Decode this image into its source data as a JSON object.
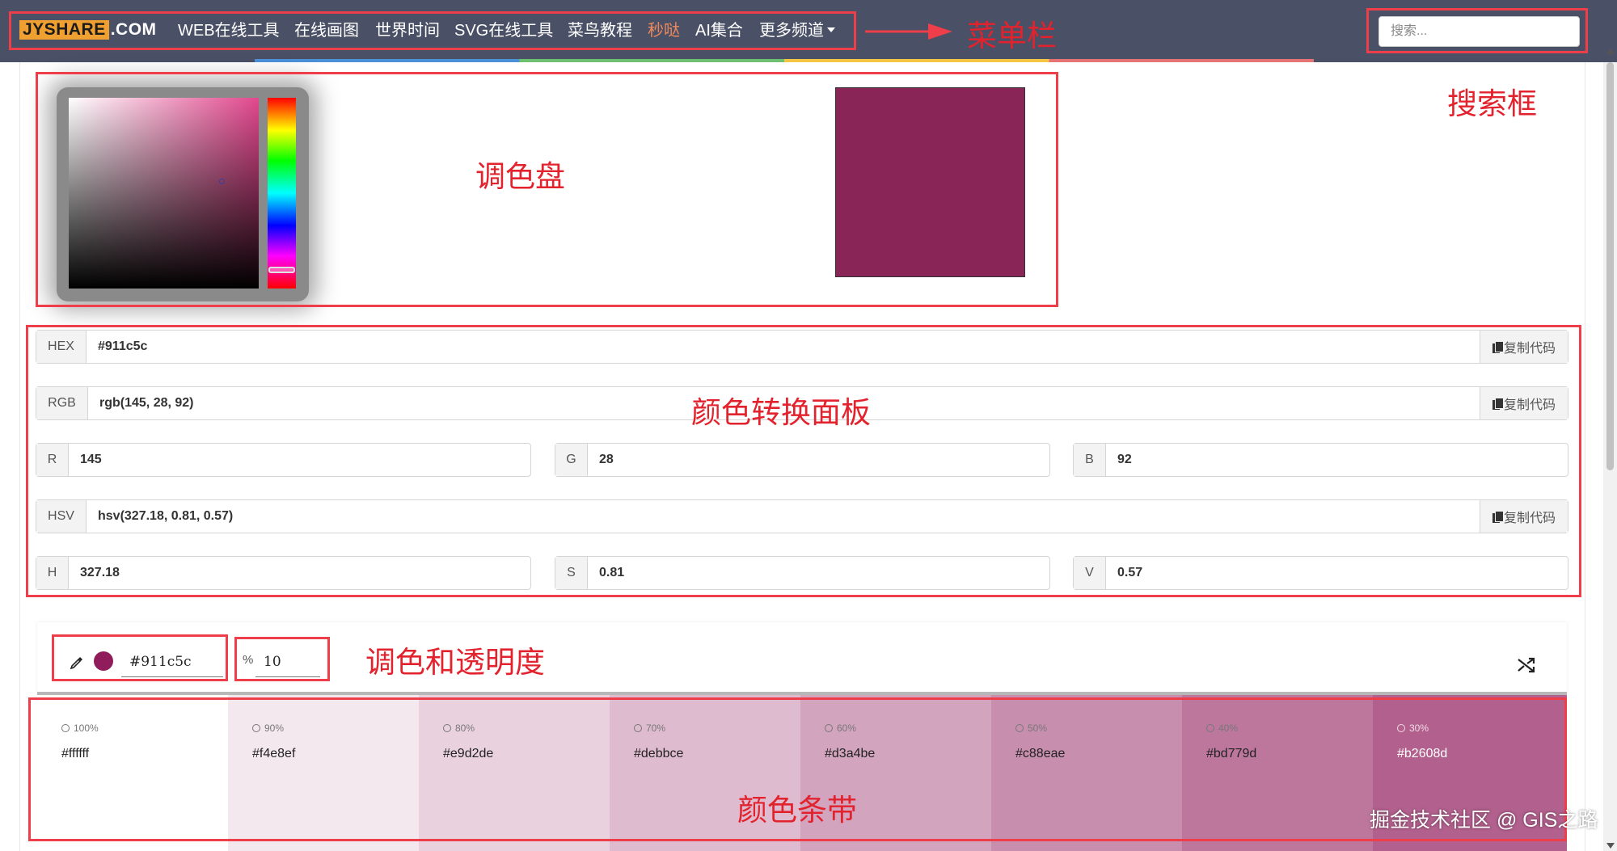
{
  "navbar": {
    "brand_box": "JYSHARE",
    "brand_suffix": ".COM",
    "items": [
      "WEB在线工具",
      "在线画图",
      "世界时间",
      "SVG在线工具",
      "菜鸟教程",
      "秒哒",
      "AI集合",
      "更多频道"
    ],
    "search_placeholder": "搜索..."
  },
  "picker": {
    "selected_color": "#911c5c",
    "hue_base_color": "#e2488e"
  },
  "conversion": {
    "hex": {
      "label": "HEX",
      "value": "#911c5c"
    },
    "rgb": {
      "label": "RGB",
      "value": "rgb(145, 28, 92)"
    },
    "r": {
      "label": "R",
      "value": "145"
    },
    "g": {
      "label": "G",
      "value": "28"
    },
    "b": {
      "label": "B",
      "value": "92"
    },
    "hsv": {
      "label": "HSV",
      "value": "hsv(327.18, 0.81, 0.57)"
    },
    "h": {
      "label": "H",
      "value": "327.18"
    },
    "s": {
      "label": "S",
      "value": "0.81"
    },
    "v": {
      "label": "V",
      "value": "0.57"
    },
    "copy_label": "复制代码"
  },
  "tint": {
    "color_hex": "#911c5c",
    "pct_symbol": "%",
    "percent": "10"
  },
  "swatches": [
    {
      "pct": "100%",
      "hex": "#ffffff"
    },
    {
      "pct": "90%",
      "hex": "#f4e8ef"
    },
    {
      "pct": "80%",
      "hex": "#e9d2de"
    },
    {
      "pct": "70%",
      "hex": "#debbce"
    },
    {
      "pct": "60%",
      "hex": "#d3a4be"
    },
    {
      "pct": "50%",
      "hex": "#c88eae"
    },
    {
      "pct": "40%",
      "hex": "#bd779d"
    },
    {
      "pct": "30%",
      "hex": "#b2608d"
    }
  ],
  "annotations": {
    "menu": "菜单栏",
    "search": "搜索框",
    "palette": "调色盘",
    "conversion": "颜色转换面板",
    "tint": "调色和透明度",
    "strip": "颜色条带"
  },
  "watermark": "掘金技术社区 @ GIS之路",
  "colors": {
    "navbar_bg": "#4a5066",
    "annotation_red": "#ee3e4a",
    "active_nav": "#f08a5d"
  }
}
